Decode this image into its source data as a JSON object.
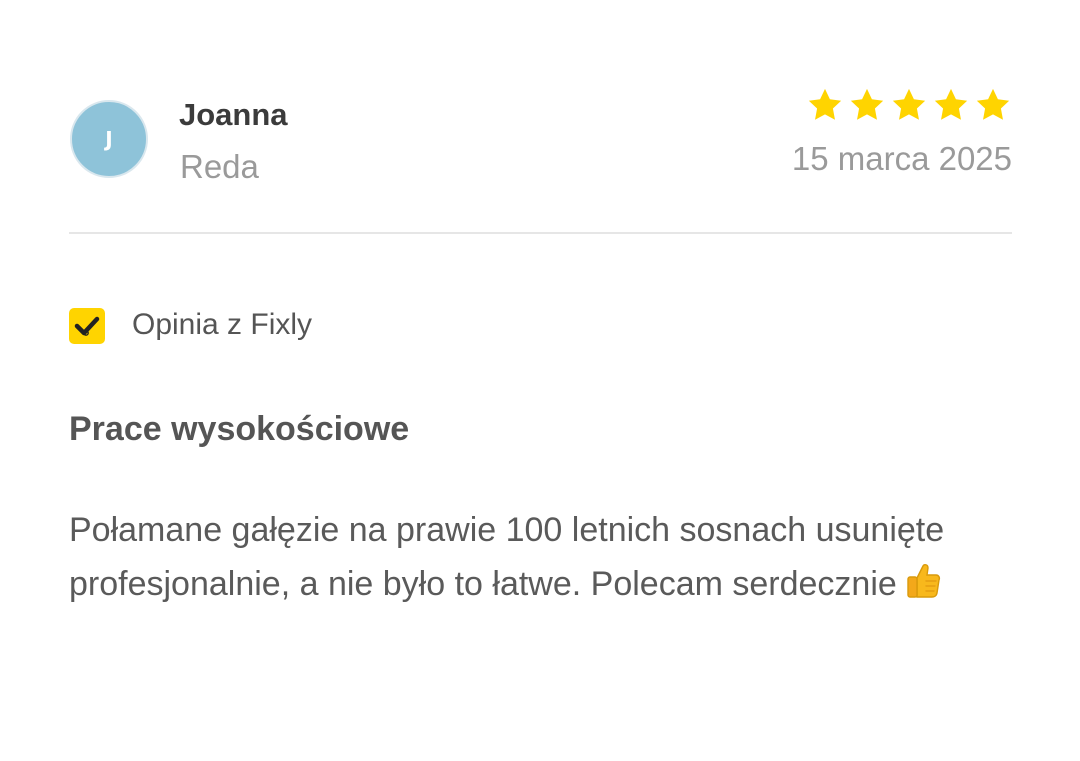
{
  "reviewer": {
    "initial": "J",
    "name": "Joanna",
    "location": "Reda",
    "avatar_color": "#8ec3d9"
  },
  "rating": {
    "stars": 5,
    "max": 5,
    "star_color": "#ffd400"
  },
  "date": "15 marca 2025",
  "source": {
    "label": "Opinia z Fixly",
    "badge_color": "#ffd400",
    "icon": "check-icon"
  },
  "review": {
    "title": "Prace wysokościowe",
    "text": "Połamane gałęzie na prawie 100 letnich sosnach usunięte profesjonalnie, a nie było to łatwe. Polecam serdecznie",
    "emoji": "thumbs-up-icon"
  }
}
